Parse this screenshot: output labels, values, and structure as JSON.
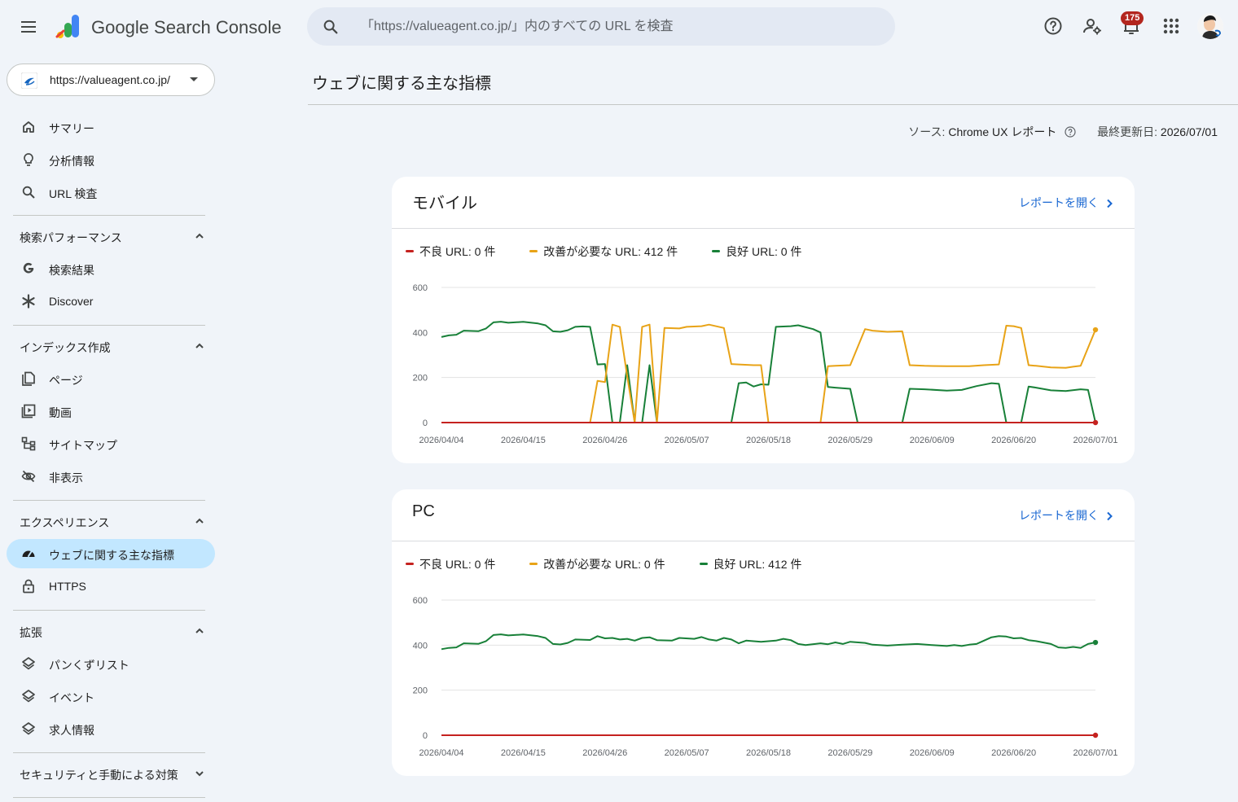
{
  "topbar": {
    "product_name": "Google Search Console",
    "search_placeholder": "「https://valueagent.co.jp/」内のすべての URL を検査",
    "notification_count": "175",
    "icons": [
      "menu-icon",
      "search-icon",
      "help-icon",
      "account-settings-icon",
      "notifications-icon",
      "apps-icon"
    ]
  },
  "sidebar": {
    "property": "https://valueagent.co.jp/",
    "top_items": [
      {
        "label": "サマリー",
        "icon": "home-icon"
      },
      {
        "label": "分析情報",
        "icon": "lightbulb-icon"
      },
      {
        "label": "URL 検査",
        "icon": "search-icon"
      }
    ],
    "sections": [
      {
        "label": "検索パフォーマンス",
        "expanded": true,
        "items": [
          {
            "label": "検索結果",
            "icon": "google-g-icon"
          },
          {
            "label": "Discover",
            "icon": "asterisk-icon"
          }
        ]
      },
      {
        "label": "インデックス作成",
        "expanded": true,
        "items": [
          {
            "label": "ページ",
            "icon": "pages-icon"
          },
          {
            "label": "動画",
            "icon": "video-icon"
          },
          {
            "label": "サイトマップ",
            "icon": "sitemap-icon"
          },
          {
            "label": "非表示",
            "icon": "visibility-off-icon"
          }
        ]
      },
      {
        "label": "エクスペリエンス",
        "expanded": true,
        "items": [
          {
            "label": "ウェブに関する主な指標",
            "icon": "speed-icon",
            "active": true
          },
          {
            "label": "HTTPS",
            "icon": "lock-icon"
          }
        ]
      },
      {
        "label": "拡張",
        "expanded": true,
        "items": [
          {
            "label": "パンくずリスト",
            "icon": "layers-icon"
          },
          {
            "label": "イベント",
            "icon": "layers-icon"
          },
          {
            "label": "求人情報",
            "icon": "layers-icon"
          }
        ]
      },
      {
        "label": "セキュリティと手動による対策",
        "expanded": false,
        "items": []
      }
    ]
  },
  "main": {
    "title": "ウェブに関する主な指標",
    "source_label": "ソース: ",
    "source_value": "Chrome UX レポート",
    "updated_label": "最終更新日: ",
    "updated_value": "2026/07/01",
    "open_report": "レポートを開く"
  },
  "colors": {
    "poor": "#c5221f",
    "needs_improvement": "#e8a317",
    "good": "#188038",
    "accent": "#1967d2"
  },
  "chart_data": [
    {
      "type": "line",
      "title": "モバイル",
      "ylim": [
        0,
        600
      ],
      "yticks": [
        0,
        200,
        400,
        600
      ],
      "x_tick_labels": [
        "2026/04/04",
        "2026/04/15",
        "2026/04/26",
        "2026/05/07",
        "2026/05/18",
        "2026/05/29",
        "2026/06/09",
        "2026/06/20",
        "2026/07/01"
      ],
      "x_start": "2026-04-04",
      "x_end": "2026-07-01",
      "grid": true,
      "legend_position": "top",
      "legend": [
        "不良 URL: 0 件",
        "改善が必要な URL: 412 件",
        "良好 URL: 0 件"
      ],
      "series": [
        {
          "name": "不良 URL",
          "color": "#c5221f",
          "points": [
            [
              "2026-04-04",
              0
            ],
            [
              "2026-07-01",
              0
            ]
          ]
        },
        {
          "name": "改善が必要な URL",
          "color": "#e8a317",
          "points": [
            [
              "2026-04-04",
              0
            ],
            [
              "2026-04-24",
              0
            ],
            [
              "2026-04-25",
              185
            ],
            [
              "2026-04-26",
              180
            ],
            [
              "2026-04-27",
              435
            ],
            [
              "2026-04-28",
              425
            ],
            [
              "2026-04-29",
              205
            ],
            [
              "2026-04-30",
              0
            ],
            [
              "2026-05-01",
              425
            ],
            [
              "2026-05-02",
              435
            ],
            [
              "2026-05-03",
              0
            ],
            [
              "2026-05-04",
              420
            ],
            [
              "2026-05-06",
              418
            ],
            [
              "2026-05-07",
              425
            ],
            [
              "2026-05-09",
              428
            ],
            [
              "2026-05-10",
              435
            ],
            [
              "2026-05-12",
              420
            ],
            [
              "2026-05-13",
              260
            ],
            [
              "2026-05-14",
              258
            ],
            [
              "2026-05-16",
              255
            ],
            [
              "2026-05-17",
              255
            ],
            [
              "2026-05-18",
              0
            ],
            [
              "2026-05-25",
              0
            ],
            [
              "2026-05-26",
              250
            ],
            [
              "2026-05-27",
              252
            ],
            [
              "2026-05-29",
              255
            ],
            [
              "2026-05-31",
              415
            ],
            [
              "2026-06-01",
              408
            ],
            [
              "2026-06-03",
              403
            ],
            [
              "2026-06-05",
              405
            ],
            [
              "2026-06-06",
              255
            ],
            [
              "2026-06-08",
              252
            ],
            [
              "2026-06-11",
              250
            ],
            [
              "2026-06-14",
              250
            ],
            [
              "2026-06-16",
              255
            ],
            [
              "2026-06-18",
              258
            ],
            [
              "2026-06-19",
              430
            ],
            [
              "2026-06-20",
              428
            ],
            [
              "2026-06-21",
              420
            ],
            [
              "2026-06-22",
              255
            ],
            [
              "2026-06-23",
              252
            ],
            [
              "2026-06-25",
              245
            ],
            [
              "2026-06-27",
              243
            ],
            [
              "2026-06-28",
              248
            ],
            [
              "2026-06-29",
              252
            ],
            [
              "2026-07-01",
              412
            ]
          ]
        },
        {
          "name": "良好 URL",
          "color": "#188038",
          "points": [
            [
              "2026-04-04",
              380
            ],
            [
              "2026-04-05",
              387
            ],
            [
              "2026-04-06",
              390
            ],
            [
              "2026-04-07",
              408
            ],
            [
              "2026-04-09",
              406
            ],
            [
              "2026-04-10",
              418
            ],
            [
              "2026-04-11",
              445
            ],
            [
              "2026-04-12",
              448
            ],
            [
              "2026-04-13",
              443
            ],
            [
              "2026-04-15",
              447
            ],
            [
              "2026-04-17",
              440
            ],
            [
              "2026-04-18",
              432
            ],
            [
              "2026-04-19",
              405
            ],
            [
              "2026-04-20",
              403
            ],
            [
              "2026-04-21",
              410
            ],
            [
              "2026-04-22",
              425
            ],
            [
              "2026-04-23",
              427
            ],
            [
              "2026-04-24",
              425
            ],
            [
              "2026-04-25",
              258
            ],
            [
              "2026-04-26",
              260
            ],
            [
              "2026-04-27",
              0
            ],
            [
              "2026-04-28",
              0
            ],
            [
              "2026-04-29",
              255
            ],
            [
              "2026-04-30",
              0
            ],
            [
              "2026-05-01",
              0
            ],
            [
              "2026-05-02",
              255
            ],
            [
              "2026-05-03",
              0
            ],
            [
              "2026-05-13",
              0
            ],
            [
              "2026-05-14",
              175
            ],
            [
              "2026-05-15",
              178
            ],
            [
              "2026-05-16",
              160
            ],
            [
              "2026-05-17",
              170
            ],
            [
              "2026-05-18",
              168
            ],
            [
              "2026-05-19",
              425
            ],
            [
              "2026-05-21",
              428
            ],
            [
              "2026-05-22",
              432
            ],
            [
              "2026-05-24",
              415
            ],
            [
              "2026-05-25",
              400
            ],
            [
              "2026-05-26",
              158
            ],
            [
              "2026-05-27",
              155
            ],
            [
              "2026-05-29",
              150
            ],
            [
              "2026-05-30",
              0
            ],
            [
              "2026-06-05",
              0
            ],
            [
              "2026-06-06",
              150
            ],
            [
              "2026-06-08",
              148
            ],
            [
              "2026-06-11",
              142
            ],
            [
              "2026-06-13",
              145
            ],
            [
              "2026-06-15",
              162
            ],
            [
              "2026-06-17",
              175
            ],
            [
              "2026-06-18",
              172
            ],
            [
              "2026-06-19",
              0
            ],
            [
              "2026-06-21",
              0
            ],
            [
              "2026-06-22",
              160
            ],
            [
              "2026-06-23",
              155
            ],
            [
              "2026-06-25",
              143
            ],
            [
              "2026-06-27",
              140
            ],
            [
              "2026-06-29",
              148
            ],
            [
              "2026-06-30",
              145
            ],
            [
              "2026-07-01",
              0
            ]
          ]
        }
      ]
    },
    {
      "type": "line",
      "title": "PC",
      "ylim": [
        0,
        600
      ],
      "yticks": [
        0,
        200,
        400,
        600
      ],
      "x_tick_labels": [
        "2026/04/04",
        "2026/04/15",
        "2026/04/26",
        "2026/05/07",
        "2026/05/18",
        "2026/05/29",
        "2026/06/09",
        "2026/06/20",
        "2026/07/01"
      ],
      "x_start": "2026-04-04",
      "x_end": "2026-07-01",
      "grid": true,
      "legend_position": "top",
      "legend": [
        "不良 URL: 0 件",
        "改善が必要な URL: 0 件",
        "良好 URL: 412 件"
      ],
      "series": [
        {
          "name": "不良 URL",
          "color": "#c5221f",
          "points": [
            [
              "2026-04-04",
              0
            ],
            [
              "2026-07-01",
              0
            ]
          ]
        },
        {
          "name": "改善が必要な URL",
          "color": "#e8a317",
          "points": [
            [
              "2026-04-04",
              0
            ],
            [
              "2026-07-01",
              0
            ]
          ]
        },
        {
          "name": "良好 URL",
          "color": "#188038",
          "points": [
            [
              "2026-04-04",
              382
            ],
            [
              "2026-04-05",
              388
            ],
            [
              "2026-04-06",
              390
            ],
            [
              "2026-04-07",
              408
            ],
            [
              "2026-04-09",
              406
            ],
            [
              "2026-04-10",
              418
            ],
            [
              "2026-04-11",
              445
            ],
            [
              "2026-04-12",
              448
            ],
            [
              "2026-04-13",
              443
            ],
            [
              "2026-04-15",
              447
            ],
            [
              "2026-04-17",
              440
            ],
            [
              "2026-04-18",
              432
            ],
            [
              "2026-04-19",
              405
            ],
            [
              "2026-04-20",
              403
            ],
            [
              "2026-04-21",
              410
            ],
            [
              "2026-04-22",
              425
            ],
            [
              "2026-04-24",
              423
            ],
            [
              "2026-04-25",
              440
            ],
            [
              "2026-04-26",
              430
            ],
            [
              "2026-04-27",
              432
            ],
            [
              "2026-04-28",
              425
            ],
            [
              "2026-04-29",
              428
            ],
            [
              "2026-04-30",
              420
            ],
            [
              "2026-05-01",
              432
            ],
            [
              "2026-05-02",
              435
            ],
            [
              "2026-05-03",
              422
            ],
            [
              "2026-05-05",
              420
            ],
            [
              "2026-05-06",
              432
            ],
            [
              "2026-05-08",
              428
            ],
            [
              "2026-05-09",
              436
            ],
            [
              "2026-05-10",
              425
            ],
            [
              "2026-05-11",
              420
            ],
            [
              "2026-05-12",
              432
            ],
            [
              "2026-05-13",
              425
            ],
            [
              "2026-05-14",
              408
            ],
            [
              "2026-05-15",
              420
            ],
            [
              "2026-05-17",
              415
            ],
            [
              "2026-05-19",
              420
            ],
            [
              "2026-05-20",
              428
            ],
            [
              "2026-05-21",
              422
            ],
            [
              "2026-05-22",
              405
            ],
            [
              "2026-05-23",
              400
            ],
            [
              "2026-05-25",
              408
            ],
            [
              "2026-05-26",
              404
            ],
            [
              "2026-05-27",
              412
            ],
            [
              "2026-05-28",
              405
            ],
            [
              "2026-05-29",
              415
            ],
            [
              "2026-05-31",
              410
            ],
            [
              "2026-06-01",
              402
            ],
            [
              "2026-06-03",
              398
            ],
            [
              "2026-06-05",
              402
            ],
            [
              "2026-06-07",
              405
            ],
            [
              "2026-06-09",
              400
            ],
            [
              "2026-06-11",
              396
            ],
            [
              "2026-06-12",
              400
            ],
            [
              "2026-06-13",
              396
            ],
            [
              "2026-06-14",
              402
            ],
            [
              "2026-06-15",
              405
            ],
            [
              "2026-06-16",
              420
            ],
            [
              "2026-06-17",
              435
            ],
            [
              "2026-06-18",
              440
            ],
            [
              "2026-06-19",
              438
            ],
            [
              "2026-06-20",
              430
            ],
            [
              "2026-06-21",
              432
            ],
            [
              "2026-06-22",
              422
            ],
            [
              "2026-06-23",
              418
            ],
            [
              "2026-06-25",
              405
            ],
            [
              "2026-06-26",
              390
            ],
            [
              "2026-06-27",
              388
            ],
            [
              "2026-06-28",
              392
            ],
            [
              "2026-06-29",
              388
            ],
            [
              "2026-06-30",
              405
            ],
            [
              "2026-07-01",
              412
            ]
          ]
        }
      ]
    }
  ]
}
